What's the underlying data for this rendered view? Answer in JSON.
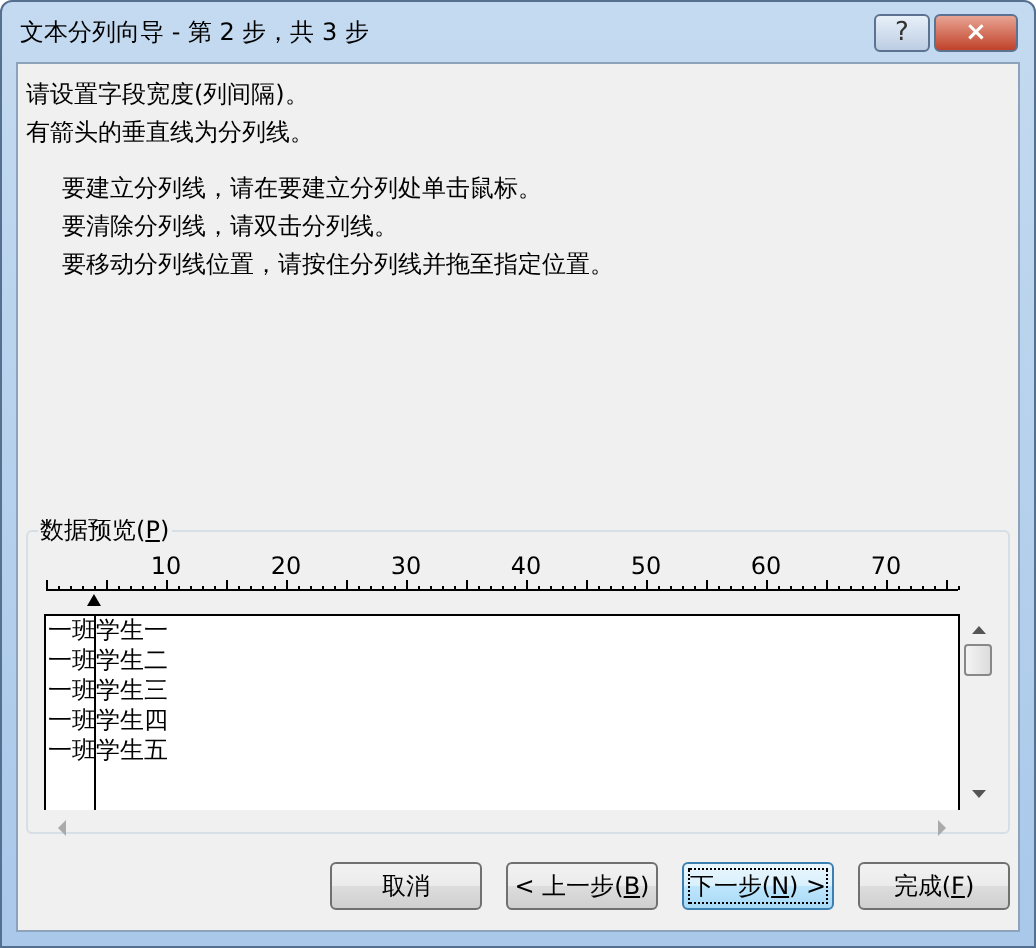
{
  "window": {
    "title": "文本分列向导 - 第 2 步，共 3 步",
    "help": "?",
    "close": "×"
  },
  "intro": [
    "请设置字段宽度(列间隔)。",
    "有箭头的垂直线为分列线。"
  ],
  "instructions": [
    "要建立分列线，请在要建立分列处单击鼠标。",
    "要清除分列线，请双击分列线。",
    "要移动分列线位置，请按住分列线并拖至指定位置。"
  ],
  "preview": {
    "label": "数据预览(P)",
    "ruler": [
      "10",
      "20",
      "30",
      "40",
      "50",
      "60",
      "70"
    ],
    "column_break": {
      "level": 0.0526
    },
    "rows": [
      "一班学生一",
      "一班学生二",
      "一班学生三",
      "一班学生四",
      "一班学生五"
    ]
  },
  "buttons": [
    {
      "label": "取消",
      "focused": false
    },
    {
      "label": "< 上一步(B)",
      "focused": false
    },
    {
      "label": "下一步(N) >",
      "focused": true
    },
    {
      "label": "完成(F)",
      "focused": false
    }
  ]
}
